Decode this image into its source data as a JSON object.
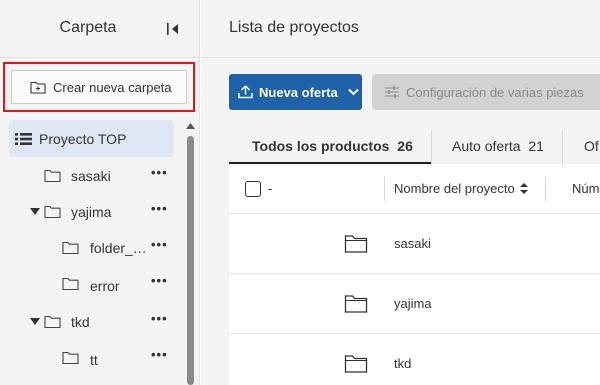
{
  "sidebar": {
    "title": "Carpeta",
    "new_folder_label": "Crear nueva carpeta",
    "root_label": "Proyecto TOP",
    "items": [
      {
        "label": "sasaki",
        "expanded": false
      },
      {
        "label": "yajima",
        "expanded": true
      },
      {
        "label": "folder_…",
        "expanded": false
      },
      {
        "label": "error",
        "expanded": false
      },
      {
        "label": "tkd",
        "expanded": true
      },
      {
        "label": "tt",
        "expanded": false
      }
    ],
    "more_label": "•••"
  },
  "main": {
    "title": "Lista de proyectos",
    "new_offer_label": "Nueva oferta",
    "config_label": "Configuración de varias piezas",
    "tabs": [
      {
        "label": "Todos los productos",
        "count": "26",
        "active": true
      },
      {
        "label": "Auto oferta",
        "count": "21",
        "active": false
      },
      {
        "label": "Of",
        "count": "",
        "active": false
      }
    ],
    "table": {
      "select_label": "-",
      "col_name": "Nombre del proyecto",
      "col_num": "Núm",
      "rows": [
        {
          "name": "sasaki"
        },
        {
          "name": "yajima"
        },
        {
          "name": "tkd"
        }
      ]
    }
  },
  "colors": {
    "primary": "#1e63aa",
    "highlight": "#d9161b",
    "selected_bg": "#dfe7f6"
  },
  "icons": {
    "collapse": "collapse-sidebar-icon",
    "new_folder": "folder-plus-icon",
    "list": "list-icon",
    "folder": "folder-icon",
    "upload": "upload-icon",
    "sliders": "sliders-icon",
    "sort": "sort-icon"
  }
}
